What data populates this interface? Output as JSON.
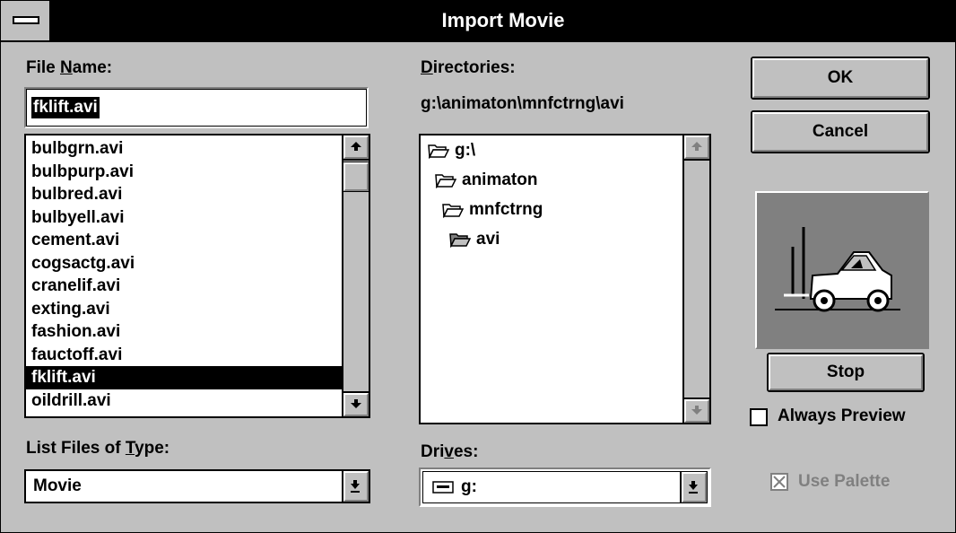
{
  "window": {
    "title": "Import Movie"
  },
  "file_name": {
    "label_pre": "File ",
    "label_u": "N",
    "label_post": "ame:",
    "value": "fklift.avi"
  },
  "file_list": {
    "items": [
      "bulbgrn.avi",
      "bulbpurp.avi",
      "bulbred.avi",
      "bulbyell.avi",
      "cement.avi",
      "cogsactg.avi",
      "cranelif.avi",
      "exting.avi",
      "fashion.avi",
      "fauctoff.avi",
      "fklift.avi",
      "oildrill.avi"
    ],
    "selected": "fklift.avi"
  },
  "directories": {
    "label_u": "D",
    "label_post": "irectories:",
    "path": "g:\\animaton\\mnfctrng\\avi",
    "items": [
      "g:\\",
      "animaton",
      "mnfctrng",
      "avi"
    ]
  },
  "file_type": {
    "label_pre": "List Files of ",
    "label_u": "T",
    "label_post": "ype:",
    "value": "Movie"
  },
  "drives": {
    "label_pre": "Dri",
    "label_u": "v",
    "label_post": "es:",
    "value": "g:"
  },
  "buttons": {
    "ok": "OK",
    "cancel": "Cancel",
    "stop": "Stop"
  },
  "options": {
    "always_preview": "Always Preview",
    "always_preview_checked": false,
    "use_palette": "Use Palette",
    "use_palette_checked": true,
    "use_palette_enabled": false
  },
  "colors": {
    "face": "#c0c0c0",
    "selection": "#000000",
    "preview_bg": "#808080"
  }
}
